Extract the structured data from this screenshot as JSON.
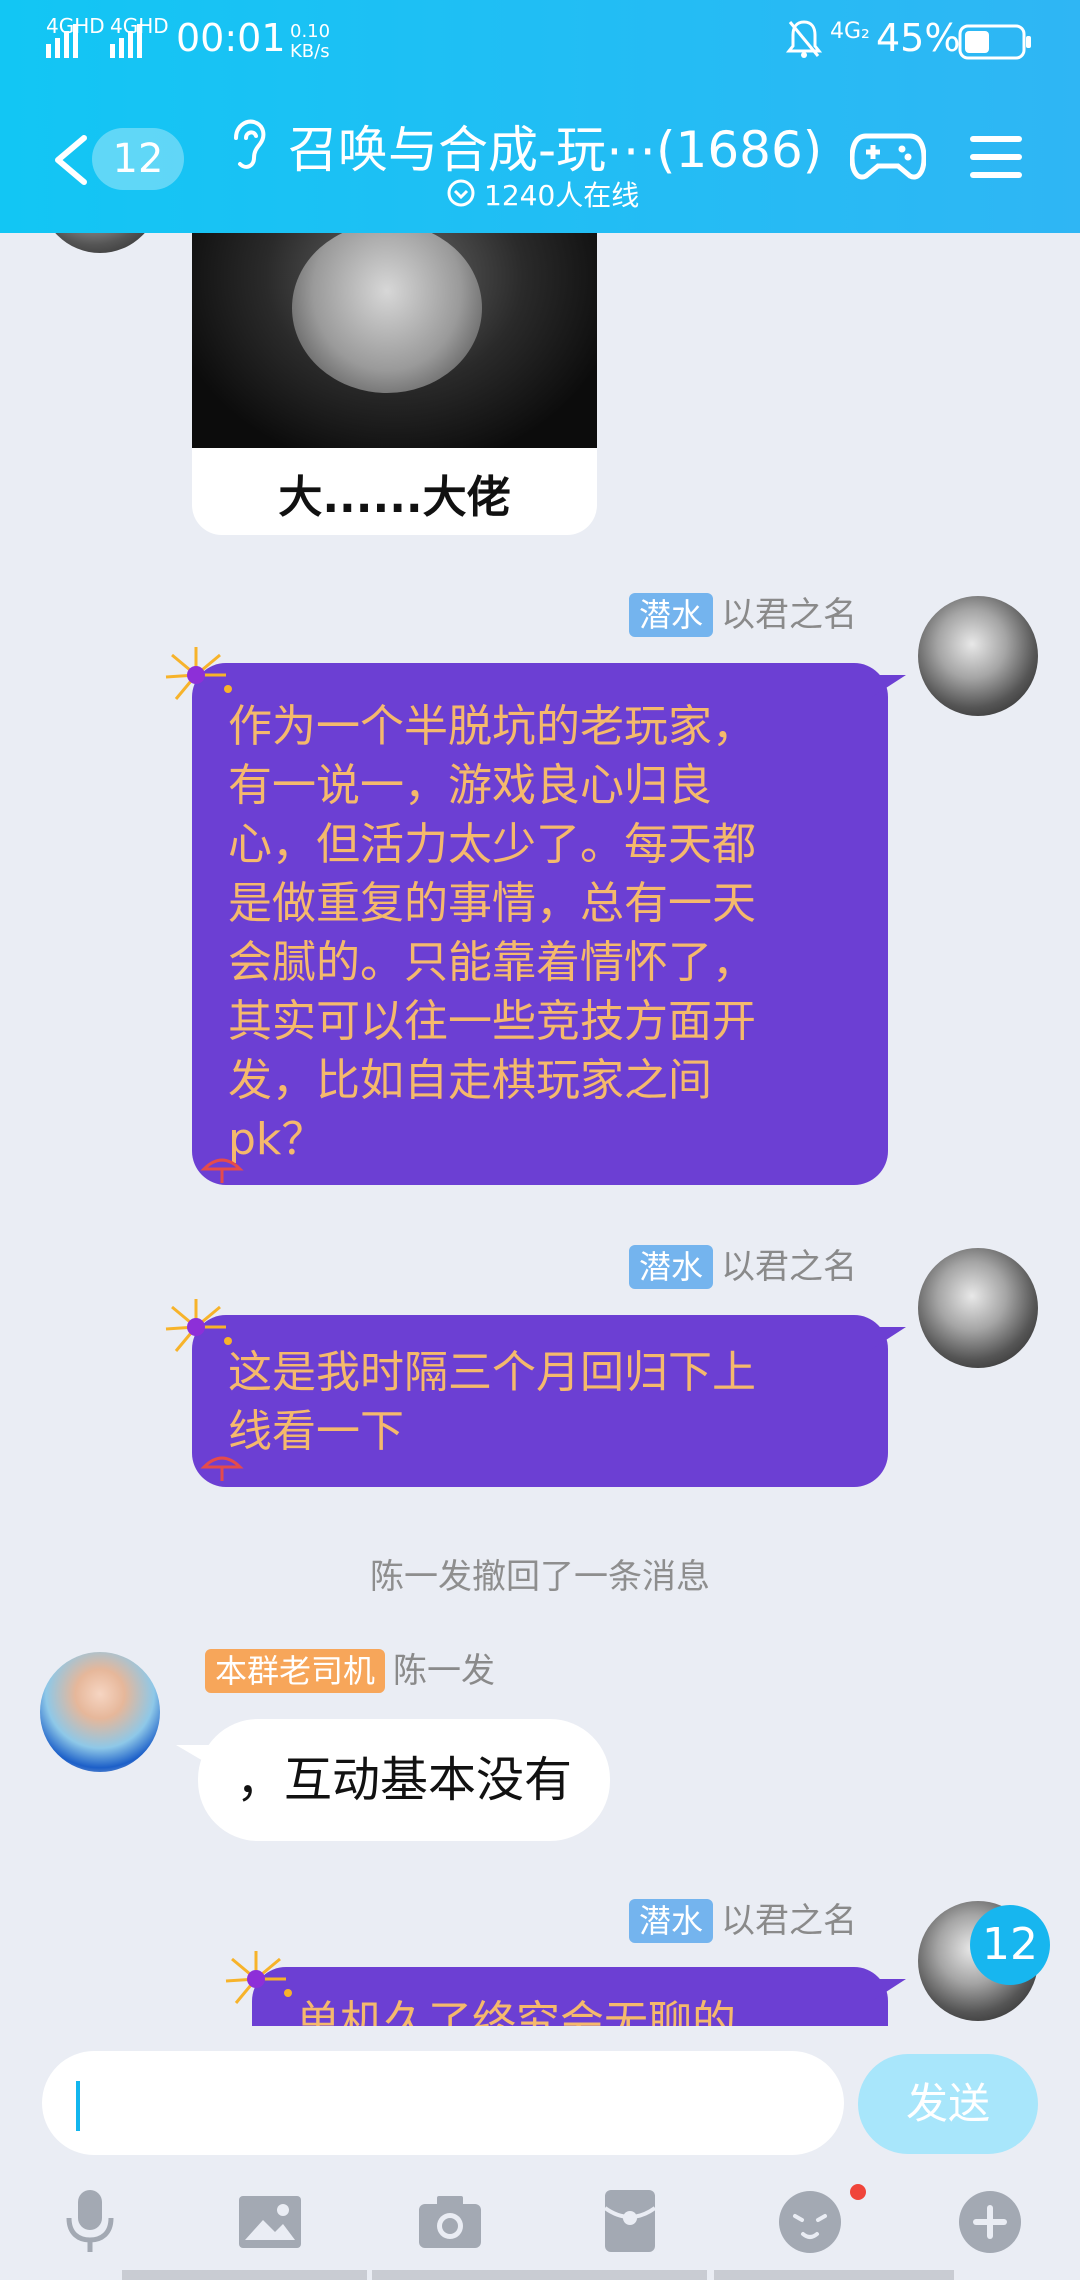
{
  "status_bar": {
    "network_1": "4GHD",
    "network_2": "4GHD",
    "time": "00:01",
    "speed_value": "0.10",
    "speed_unit": "KB/s",
    "sim_label": "4G₂",
    "battery": "45%",
    "battery_level": 0.45
  },
  "header": {
    "unread_count": "12",
    "title": "召唤与合成-玩⋯(1686)",
    "online": "1240人在线"
  },
  "chat": {
    "meme_caption": "大......大佬",
    "messages": [
      {
        "badge": "潜水",
        "sender": "以君之名",
        "text": "作为一个半脱坑的老玩家，\n有一说一，游戏良心归良\n心，但活力太少了。每天都\n是做重复的事情，总有一天\n会腻的。只能靠着情怀了，\n其实可以往一些竞技方面开\n发，比如自走棋玩家之间\npk？"
      },
      {
        "badge": "潜水",
        "sender": "以君之名",
        "text": "这是我时隔三个月回归下上\n线看一下"
      },
      {
        "badge": "本群老司机",
        "sender": "陈一发",
        "text": "，互动基本没有"
      },
      {
        "badge": "潜水",
        "sender": "以君之名",
        "text": "单机久了终究会无聊的"
      }
    ],
    "system_message": "陈一发撤回了一条消息",
    "new_messages_badge": "12"
  },
  "input": {
    "value": "",
    "send_label": "发送"
  },
  "colors": {
    "header": "#12c6f4",
    "bubble_purple": "#6c3fd3",
    "bubble_text": "#f5b96c",
    "badge_blue": "#74b4ee",
    "badge_orange": "#f7a65a",
    "send_button": "#a8e6fb"
  },
  "icons": {
    "toolbar": [
      "microphone-icon",
      "image-icon",
      "camera-icon",
      "red-packet-icon",
      "emoji-icon",
      "plus-icon"
    ]
  }
}
